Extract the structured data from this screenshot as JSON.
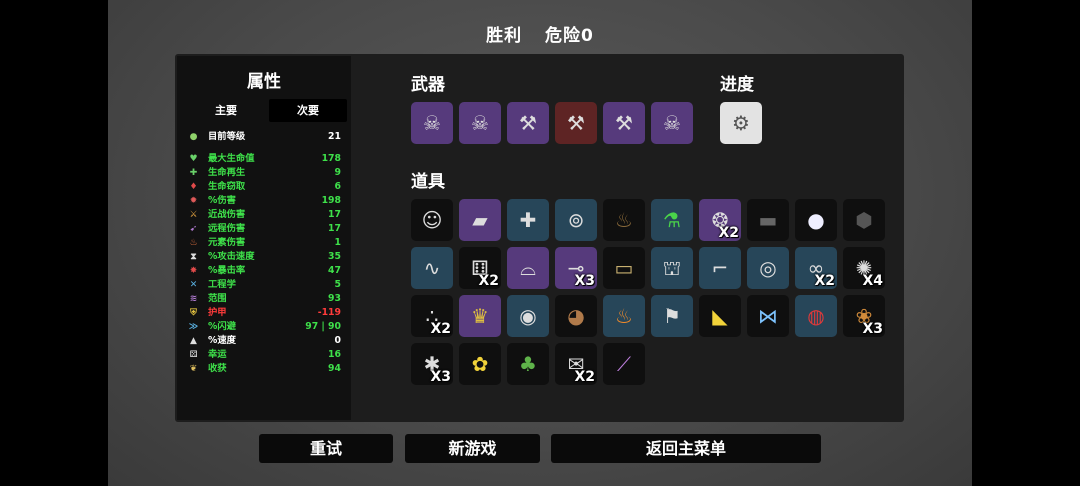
{
  "header": {
    "result": "胜利",
    "danger": "危险0"
  },
  "stats_panel": {
    "title": "属性",
    "tab_primary": "主要",
    "tab_secondary": "次要",
    "level": {
      "label": "目前等级",
      "value": "21"
    },
    "stats": [
      {
        "label": "最大生命值",
        "value": "178",
        "color": "#3ee04a",
        "icon": "heart-icon"
      },
      {
        "label": "生命再生",
        "value": "9",
        "color": "#3ee04a",
        "icon": "regen-icon"
      },
      {
        "label": "生命窃取",
        "value": "6",
        "color": "#3ee04a",
        "icon": "lifesteal-icon"
      },
      {
        "label": "%伤害",
        "value": "198",
        "color": "#3ee04a",
        "icon": "damage-icon"
      },
      {
        "label": "近战伤害",
        "value": "17",
        "color": "#3ee04a",
        "icon": "melee-icon"
      },
      {
        "label": "远程伤害",
        "value": "17",
        "color": "#3ee04a",
        "icon": "ranged-icon"
      },
      {
        "label": "元素伤害",
        "value": "1",
        "color": "#3ee04a",
        "icon": "elemental-icon"
      },
      {
        "label": "%攻击速度",
        "value": "35",
        "color": "#3ee04a",
        "icon": "attack-speed-icon"
      },
      {
        "label": "%暴击率",
        "value": "47",
        "color": "#3ee04a",
        "icon": "crit-icon"
      },
      {
        "label": "工程学",
        "value": "5",
        "color": "#3ee04a",
        "icon": "engineering-icon"
      },
      {
        "label": "范围",
        "value": "93",
        "color": "#3ee04a",
        "icon": "range-icon"
      },
      {
        "label": "护甲",
        "value": "-119",
        "color": "#ff3b3b",
        "icon": "armor-icon"
      },
      {
        "label": "%闪避",
        "value": "97 | 90",
        "color": "#3ee04a",
        "icon": "dodge-icon"
      },
      {
        "label": "%速度",
        "value": "0",
        "color": "#ffffff",
        "icon": "speed-icon"
      },
      {
        "label": "幸运",
        "value": "16",
        "color": "#3ee04a",
        "icon": "luck-icon"
      },
      {
        "label": "收获",
        "value": "94",
        "color": "#3ee04a",
        "icon": "harvest-icon"
      }
    ]
  },
  "weapons": {
    "title": "武器",
    "items": [
      {
        "icon": "skull-axe-icon",
        "tier": "purple"
      },
      {
        "icon": "skull-axe-icon",
        "tier": "purple"
      },
      {
        "icon": "axe-icon",
        "tier": "purple"
      },
      {
        "icon": "axe-icon",
        "tier": "red"
      },
      {
        "icon": "axe-icon",
        "tier": "purple"
      },
      {
        "icon": "skull-axe-icon",
        "tier": "purple"
      }
    ]
  },
  "progress": {
    "title": "进度",
    "items": [
      {
        "icon": "crown-trap-icon",
        "tier": "white"
      }
    ]
  },
  "items": {
    "title": "道具",
    "list": [
      {
        "icon": "ghost-mask-icon",
        "tier": "none",
        "count": ""
      },
      {
        "icon": "scrap-metal-icon",
        "tier": "purple",
        "count": ""
      },
      {
        "icon": "medic-bot-icon",
        "tier": "blue",
        "count": ""
      },
      {
        "icon": "binoculars-icon",
        "tier": "blue",
        "count": ""
      },
      {
        "icon": "poop-icon",
        "tier": "none",
        "count": ""
      },
      {
        "icon": "potion-icon",
        "tier": "blue",
        "count": ""
      },
      {
        "icon": "tardigrade-icon",
        "tier": "purple",
        "count": "X2"
      },
      {
        "icon": "coal-icon",
        "tier": "none",
        "count": ""
      },
      {
        "icon": "snowball-icon",
        "tier": "none",
        "count": ""
      },
      {
        "icon": "rock-icon",
        "tier": "none",
        "count": ""
      },
      {
        "icon": "worm-icon",
        "tier": "blue",
        "count": ""
      },
      {
        "icon": "dice-icon",
        "tier": "none",
        "count": "X2"
      },
      {
        "icon": "mortar-icon",
        "tier": "purple",
        "count": ""
      },
      {
        "icon": "cannon-icon",
        "tier": "purple",
        "count": "X3"
      },
      {
        "icon": "cash-icon",
        "tier": "none",
        "count": ""
      },
      {
        "icon": "turret-icon",
        "tier": "blue",
        "count": ""
      },
      {
        "icon": "crane-icon",
        "tier": "blue",
        "count": ""
      },
      {
        "icon": "pendant-icon",
        "tier": "blue",
        "count": ""
      },
      {
        "icon": "glasses-icon",
        "tier": "blue",
        "count": "X2"
      },
      {
        "icon": "hedgehog-icon",
        "tier": "none",
        "count": "X4"
      },
      {
        "icon": "dots-icon",
        "tier": "none",
        "count": "X2"
      },
      {
        "icon": "crown-icon",
        "tier": "purple",
        "count": ""
      },
      {
        "icon": "diving-helmet-icon",
        "tier": "blue",
        "count": ""
      },
      {
        "icon": "monkey-icon",
        "tier": "none",
        "count": ""
      },
      {
        "icon": "campfire-icon",
        "tier": "blue",
        "count": ""
      },
      {
        "icon": "flag-icon",
        "tier": "blue",
        "count": ""
      },
      {
        "icon": "duck-icon",
        "tier": "none",
        "count": ""
      },
      {
        "icon": "butterfly-icon",
        "tier": "none",
        "count": ""
      },
      {
        "icon": "shield-ring-icon",
        "tier": "blue",
        "count": ""
      },
      {
        "icon": "squirrel-icon",
        "tier": "none",
        "count": "X3"
      },
      {
        "icon": "spider-icon",
        "tier": "none",
        "count": "X3"
      },
      {
        "icon": "bee-icon",
        "tier": "none",
        "count": ""
      },
      {
        "icon": "tree-icon",
        "tier": "none",
        "count": ""
      },
      {
        "icon": "scroll-icon",
        "tier": "none",
        "count": "X2"
      },
      {
        "icon": "syringe-icon",
        "tier": "none",
        "count": ""
      }
    ]
  },
  "buttons": {
    "retry": "重试",
    "new_game": "新游戏",
    "main_menu": "返回主菜单"
  }
}
